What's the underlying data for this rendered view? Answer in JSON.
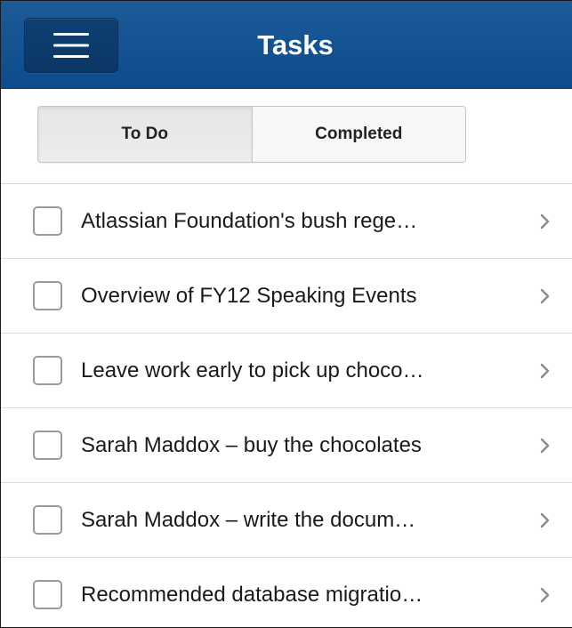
{
  "header": {
    "title": "Tasks",
    "menu_icon": "hamburger-menu-icon",
    "colors": {
      "bar": "#0d4c8c",
      "button": "#0b3766"
    }
  },
  "tabs": {
    "items": [
      {
        "label": "To Do",
        "active": true
      },
      {
        "label": "Completed",
        "active": false
      }
    ]
  },
  "tasks": [
    {
      "title": "Atlassian Foundation's bush rege…",
      "checked": false
    },
    {
      "title": "Overview of FY12 Speaking Events",
      "checked": false
    },
    {
      "title": "Leave work early to pick up choco…",
      "checked": false
    },
    {
      "title": "Sarah Maddox – buy the chocolates",
      "checked": false
    },
    {
      "title": "Sarah Maddox – write the docum…",
      "checked": false
    },
    {
      "title": "Recommended database migratio…",
      "checked": false
    }
  ],
  "row_icon": "chevron-right-icon"
}
